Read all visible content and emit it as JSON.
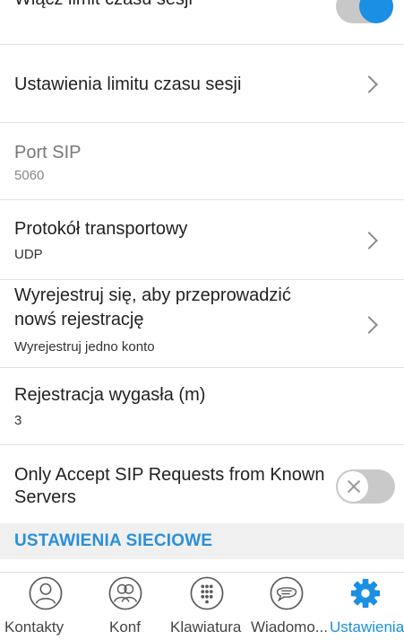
{
  "settings": {
    "top_row": {
      "label": "Włącz limit czasu sesji"
    },
    "session_limit": {
      "label": "Ustawienia limitu czasu sesji"
    },
    "sip_port": {
      "label": "Port SIP",
      "value": "5060"
    },
    "transport": {
      "label": "Protokół transportowy",
      "value": "UDP"
    },
    "unregister": {
      "label_line1": "Wyrejestruj się, aby przeprowadzić",
      "label_line2": "nowś rejestrację",
      "value": "Wyrejestruj jedno konto"
    },
    "expiry": {
      "label": "Rejestracja wygasła (m)",
      "value": "3"
    },
    "known_servers": {
      "label_line1": "Only Accept SIP Requests from Known",
      "label_line2": "Servers",
      "enabled": false
    }
  },
  "section": {
    "network": "USTAWIENIA SIECIOWE"
  },
  "tabs": [
    {
      "label": "Kontakty",
      "icon": "contact-icon"
    },
    {
      "label": "Konf",
      "icon": "conference-icon"
    },
    {
      "label": "Klawiatura",
      "icon": "dialpad-icon"
    },
    {
      "label": "Wiadomo...",
      "icon": "message-icon"
    },
    {
      "label": "Ustawienia",
      "icon": "gear-icon",
      "active": true
    }
  ],
  "colors": {
    "accent": "#1a8fe3",
    "section_bg": "#f0f0f0",
    "divider": "#e2e2e2"
  }
}
